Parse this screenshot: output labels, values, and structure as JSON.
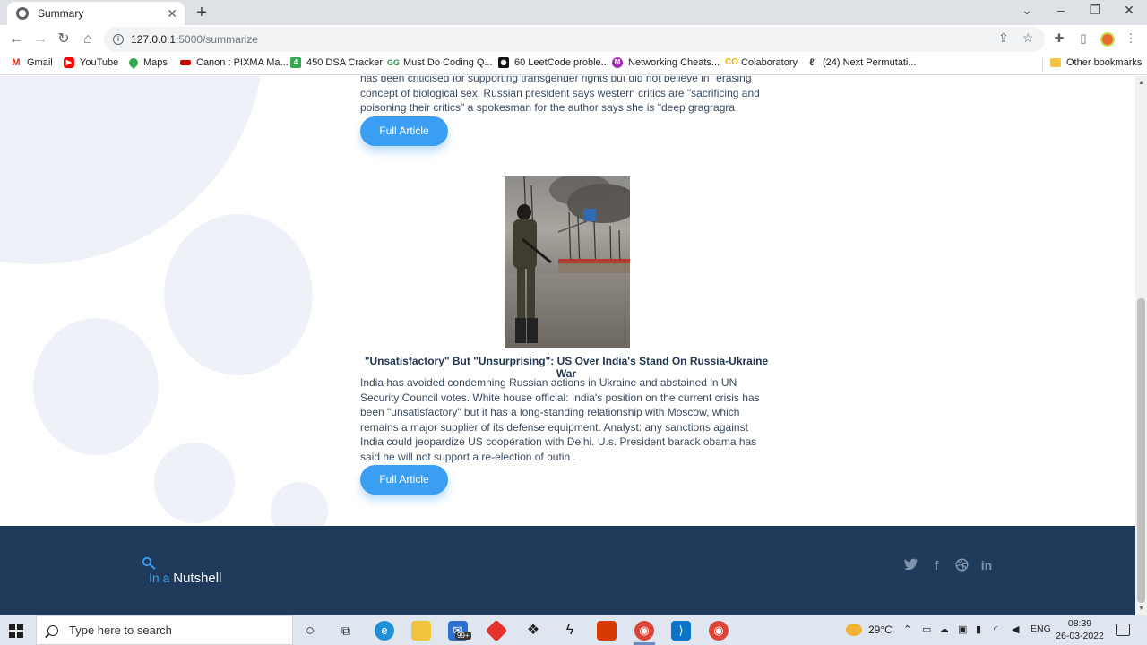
{
  "browser": {
    "tab_title": "Summary",
    "tab_close": "✕",
    "new_tab": "+",
    "url_host": "127.0.0.1",
    "url_path": ":5000/summarize",
    "bookmarks": [
      {
        "label": "Gmail",
        "icon": "gmail-icon",
        "color": "#d93025"
      },
      {
        "label": "YouTube",
        "icon": "youtube-icon",
        "color": "#ff0000"
      },
      {
        "label": "Maps",
        "icon": "maps-icon",
        "color": "#34a853"
      },
      {
        "label": "Canon : PIXMA Ma...",
        "icon": "canon-icon",
        "color": "#cc0000"
      },
      {
        "label": "450 DSA Cracker",
        "icon": "dsa-icon",
        "color": "#34a853"
      },
      {
        "label": "Must Do Coding Q...",
        "icon": "gfg-icon",
        "color": "#2f8d46"
      },
      {
        "label": "60 LeetCode proble...",
        "icon": "leetcode-icon",
        "color": "#111111"
      },
      {
        "label": "Networking Cheats...",
        "icon": "notion-icon",
        "color": "#a22fb3"
      },
      {
        "label": "Colaboratory",
        "icon": "colab-icon",
        "color": "#f9ab00"
      },
      {
        "label": "(24) Next Permutati...",
        "icon": "link-icon",
        "color": "#333333"
      }
    ],
    "other_bookmarks": "Other bookmarks"
  },
  "articles": [
    {
      "summary": "has been criticised for supporting transgender rights but did not believe in \"erasing concept of biological sex. Russian president says western critics are \"sacrificing and poisoning their critics\" a spokesman for the author says she is \"deep gragragra",
      "button": "Full Article"
    },
    {
      "headline": "\"Unsatisfactory\" But \"Unsurprising\": US Over India's Stand On Russia-Ukraine War",
      "summary": "India has avoided condemning Russian actions in Ukraine and abstained in UN Security Council votes. White house official: India's position on the current crisis has been \"unsatisfactory\" but it has a long-standing relationship with Moscow, which remains a major supplier of its defense equipment. Analyst: any sanctions against India could jeopardize US cooperation with Delhi. U.s. President barack obama has said he will not support a re-election of putin .",
      "button": "Full Article"
    }
  ],
  "footer": {
    "logo_prefix": "In a ",
    "logo_main": "Nutshell",
    "social": [
      "twitter-icon",
      "facebook-icon",
      "dribbble-icon",
      "linkedin-icon"
    ]
  },
  "taskbar": {
    "search_placeholder": "Type here to search",
    "mail_badge": "99+",
    "weather": "29°C",
    "language": "ENG",
    "time": "08:39",
    "date": "26-03-2022"
  },
  "colors": {
    "accent": "#3a9ff2",
    "footer_bg": "#1f3a5a",
    "headline": "#1f3550"
  }
}
